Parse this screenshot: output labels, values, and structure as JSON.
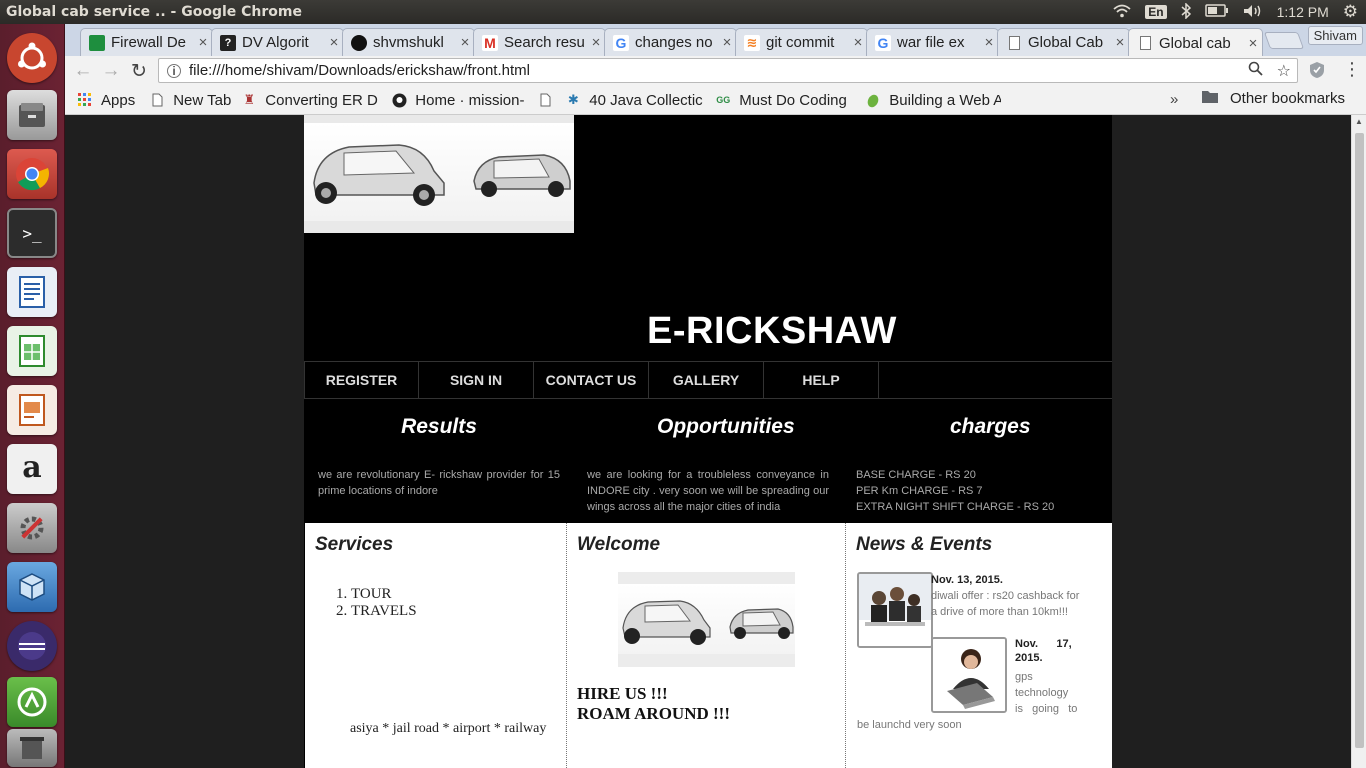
{
  "panel": {
    "window_title": "Global cab service .. - Google Chrome",
    "keyboard": "En",
    "time": "1:12 PM"
  },
  "tabs": [
    {
      "label": "Firewall De",
      "icon": "classroom-icon",
      "color": "#1e8e3e"
    },
    {
      "label": "DV Algorit",
      "icon": "question-icon",
      "color": "#222222"
    },
    {
      "label": "shvmshukl",
      "icon": "github-icon",
      "color": "#111111"
    },
    {
      "label": "Search resu",
      "icon": "gmail-icon",
      "color": "#d93025"
    },
    {
      "label": "changes no",
      "icon": "google-icon",
      "color": "#4285f4"
    },
    {
      "label": "git commit",
      "icon": "stackoverflow-icon",
      "color": "#f48024"
    },
    {
      "label": "war file ex",
      "icon": "google-icon",
      "color": "#4285f4"
    },
    {
      "label": "Global Cab",
      "icon": "page-icon",
      "color": "#888888"
    },
    {
      "label": "Global cab",
      "icon": "page-icon",
      "color": "#888888"
    }
  ],
  "profile_name": "Shivam",
  "address": {
    "url": "file:///home/shivam/Downloads/erickshaw/front.html"
  },
  "bookmarks": {
    "apps": "Apps",
    "items": [
      {
        "label": "New Tab",
        "icon": "page-icon"
      },
      {
        "label": "Converting ER D",
        "icon": "iitk-icon"
      },
      {
        "label": "Home · mission-",
        "icon": "github-icon"
      },
      {
        "label": "",
        "icon": "page-icon"
      },
      {
        "label": "40 Java Collectic",
        "icon": "java-icon"
      },
      {
        "label": "Must Do Coding",
        "icon": "gfg-icon"
      },
      {
        "label": "Building a Web A",
        "icon": "spring-icon"
      }
    ],
    "more": "»",
    "other": "Other bookmarks"
  },
  "site": {
    "title": "E-RICKSHAW",
    "nav": [
      "REGISTER",
      "SIGN IN",
      "CONTACT US",
      "GALLERY",
      "HELP"
    ],
    "columns": [
      {
        "heading": "Results",
        "text": "we are revolutionary E- rickshaw provider for 15 prime locations of indore"
      },
      {
        "heading": "Opportunities",
        "text": "we are looking for a troubleless conveyance in INDORE city . very soon we will be spreading our wings across all the major cities of india"
      },
      {
        "heading": "charges",
        "lines": [
          "BASE CHARGE - RS 20",
          "PER Km CHARGE - RS 7",
          "EXTRA NIGHT SHIFT CHARGE - RS 20"
        ]
      }
    ],
    "services": {
      "heading": "Services",
      "items": [
        "TOUR",
        "TRAVELS"
      ],
      "marquee": "asiya * jail road * airport * railway"
    },
    "welcome": {
      "heading": "Welcome",
      "hire_line1": "HIRE US !!!",
      "hire_line2": "ROAM AROUND !!!"
    },
    "news": {
      "heading": "News & Events",
      "items": [
        {
          "date": "Nov. 13, 2015.",
          "text": "diwali offer : rs20 cashback for a drive of more than 10km!!!"
        },
        {
          "date_line1": "Nov.      17,",
          "date_line2": "2015.",
          "text_lines": [
            "gps",
            "technology",
            "is   going   to"
          ],
          "text_tail": "be launchd very soon"
        }
      ]
    }
  }
}
